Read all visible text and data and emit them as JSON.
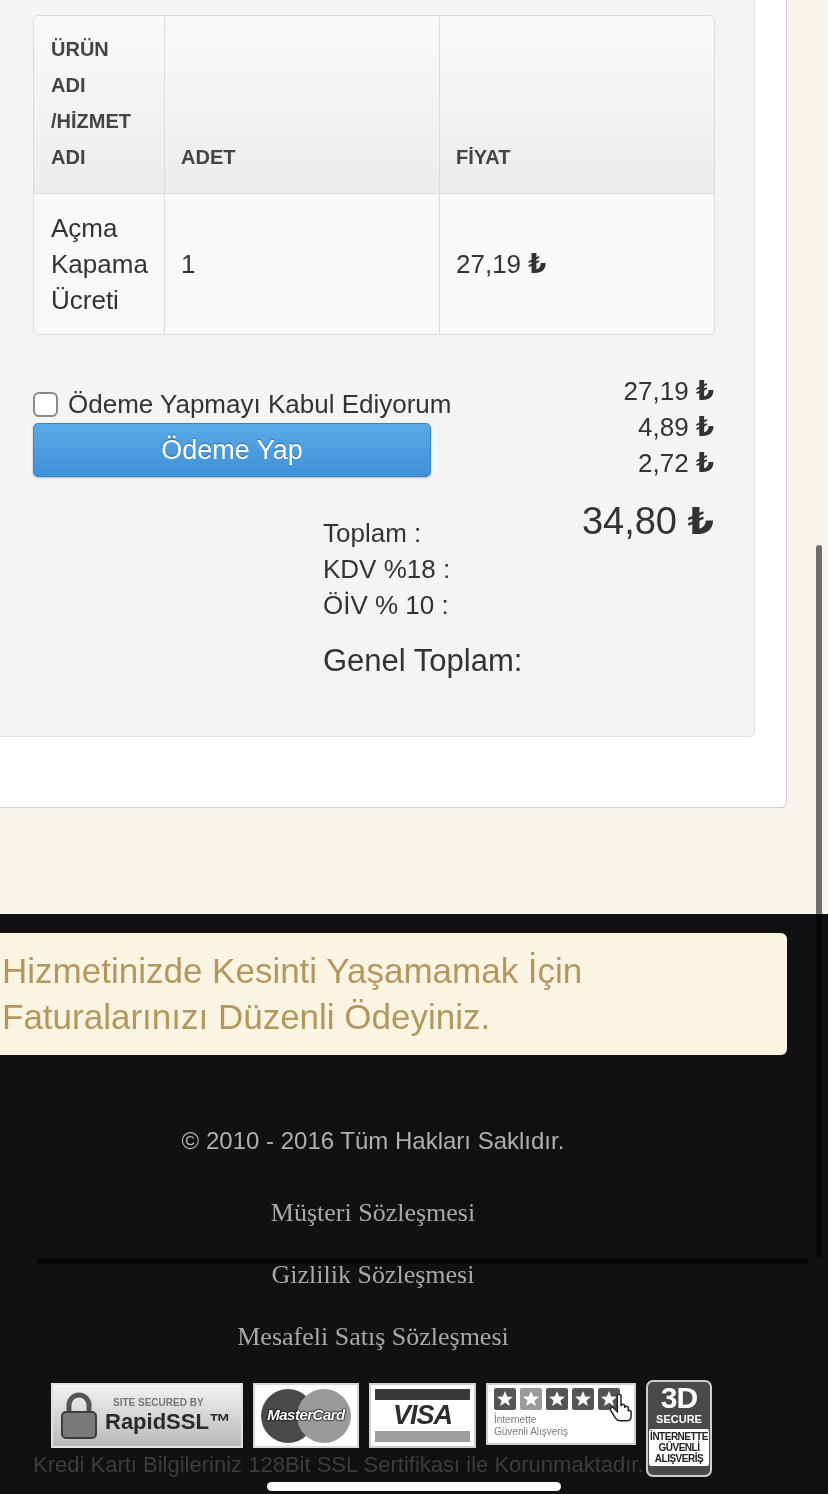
{
  "order_table": {
    "columns": [
      {
        "label": "ÜRÜN ADI /HİZMET ADI"
      },
      {
        "label": "ADET"
      },
      {
        "label": "FİYAT"
      }
    ],
    "rows": [
      {
        "cells": [
          "Açma Kapama Ücreti",
          "1",
          "27,19 **₺**"
        ]
      }
    ]
  },
  "payment": {
    "agreement": {
      "label": "Ödeme Yapmayı Kabul Ediyorum",
      "checked": false
    },
    "pay_button": "Ödeme Yap"
  },
  "amounts": [
    "27,19 **₺**",
    "4,89 **₺**",
    "2,72 **₺**"
  ],
  "grand_total": "34,80 **₺**",
  "summary_labels": [
    "Toplam :",
    "KDV %18 :",
    "ÖİV % 10 :"
  ],
  "grand_total_label": "Genel Toplam:",
  "footer": {
    "notice": "Hizmetinizde Kesinti Yaşamamak İçin Faturalarınızı Düzenli Ödeyiniz.",
    "copyright": "© 2010 - 2016 Tüm Hakları Saklıdır.",
    "links": [
      "Müşteri Sözleşmesi",
      "Gizlilik Sözleşmesi",
      "Mesafeli Satış Sözleşmesi"
    ],
    "badges": [
      {
        "kind": "seal",
        "caption": "SITE SECURED BY",
        "title": "RapidSSL™"
      },
      {
        "kind": "circles",
        "title": "MasterCard"
      },
      {
        "kind": "striped",
        "title": "VISA"
      },
      {
        "kind": "stars",
        "lines": [
          "İnternette",
          "Güvenli Alışveriş"
        ]
      },
      {
        "kind": "secure3d",
        "title": "3D",
        "caption": "SECURE",
        "lines": [
          "İNTERNETTE",
          "GÜVENLİ",
          "ALIŞVERİŞ"
        ]
      }
    ],
    "ssl_note": "Kredi Kartı Bilgileriniz 128Bit SSL Sertifikası ile Korunmaktadır."
  }
}
